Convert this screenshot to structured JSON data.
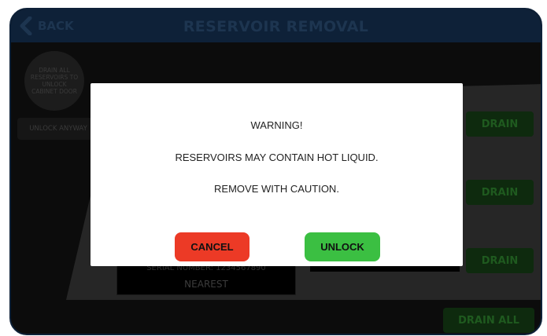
{
  "header": {
    "back_label": "BACK",
    "title": "RESERVOIR REMOVAL"
  },
  "side": {
    "drain_all_notice": "DRAIN ALL RESERVOIRS TO UNLOCK CABINET DOOR",
    "unlock_anyway_label": "UNLOCK ANYWAY"
  },
  "reservoirs": {
    "drain_label": "DRAIN",
    "drain_all_label": "DRAIN ALL",
    "box_line1": "SERIAL NUMBER: 1234567890",
    "box_line2": "NEAREST"
  },
  "modal": {
    "heading": "WARNING!",
    "message1": "RESERVOIRS MAY CONTAIN HOT LIQUID.",
    "message2": "REMOVE WITH CAUTION.",
    "cancel_label": "CANCEL",
    "unlock_label": "UNLOCK"
  },
  "colors": {
    "header_bg": "#0e2138",
    "cancel": "#ec3a26",
    "unlock": "#3bbf42",
    "drain_dim": "#0e2a0e"
  }
}
